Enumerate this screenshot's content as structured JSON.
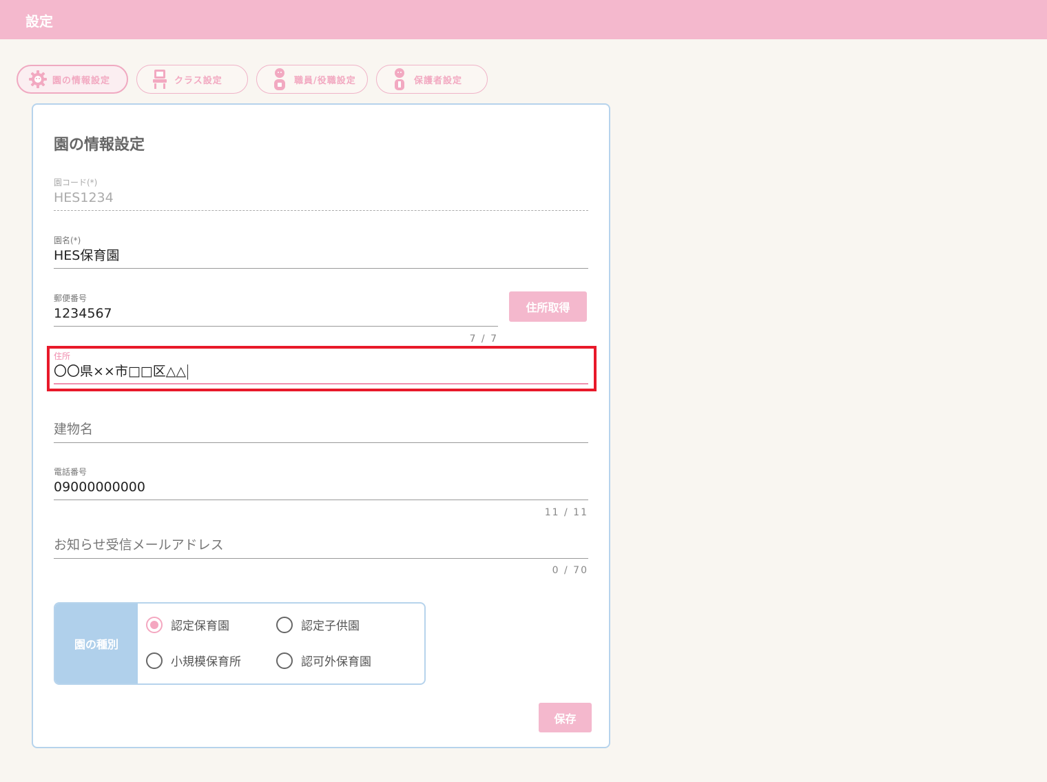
{
  "header": {
    "title": "設定"
  },
  "tabs": [
    {
      "label": "園の情報設定",
      "icon": "gear-icon",
      "active": true
    },
    {
      "label": "クラス設定",
      "icon": "class-icon",
      "active": false
    },
    {
      "label": "職員/役職設定",
      "icon": "staff-icon",
      "active": false
    },
    {
      "label": "保護者設定",
      "icon": "guardian-icon",
      "active": false
    }
  ],
  "card": {
    "title": "園の情報設定",
    "fields": {
      "code": {
        "label": "園コード(*)",
        "value": "HES1234"
      },
      "name": {
        "label": "園名(*)",
        "value": "HES保育園"
      },
      "postal": {
        "label": "郵便番号",
        "value": "1234567",
        "counter": "7 / 7"
      },
      "address": {
        "label": "住所",
        "value": "〇〇県××市□□区△△"
      },
      "building": {
        "label": "建物名",
        "value": ""
      },
      "phone": {
        "label": "電話番号",
        "value": "09000000000",
        "counter": "11 / 11"
      },
      "email": {
        "label": "お知らせ受信メールアドレス",
        "value": "",
        "counter": "0 / 70"
      }
    },
    "address_button": "住所取得",
    "type": {
      "label": "園の種別",
      "options": [
        "認定保育園",
        "認定子供園",
        "小規模保育所",
        "認可外保育園"
      ],
      "selected": "認定保育園"
    },
    "save_button": "保存"
  },
  "colors": {
    "header": "#f4b8cd",
    "accent_pink": "#f08eae",
    "card_border": "#b6d3ec",
    "type_head": "#b0d0eb",
    "highlight": "#e8192a"
  }
}
